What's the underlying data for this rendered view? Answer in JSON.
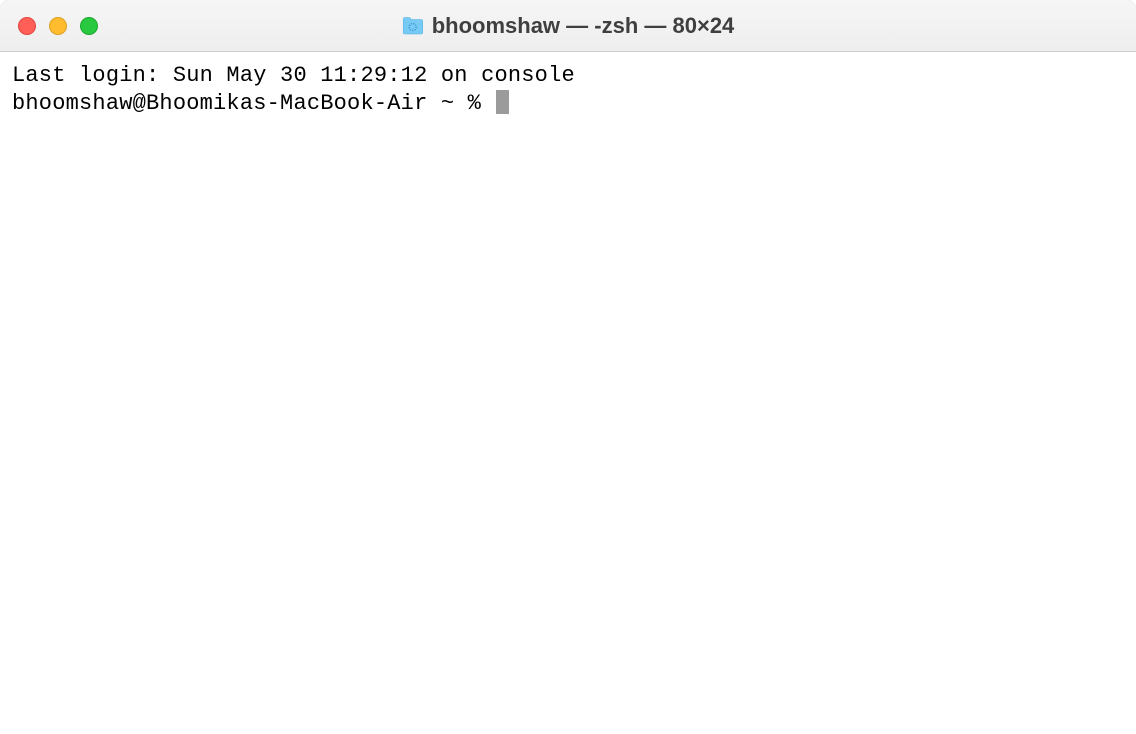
{
  "window": {
    "title": "bhoomshaw — -zsh — 80×24"
  },
  "terminal": {
    "last_login": "Last login: Sun May 30 11:29:12 on console",
    "prompt": "bhoomshaw@Bhoomikas-MacBook-Air ~ % "
  },
  "colors": {
    "close": "#ff5f57",
    "minimize": "#febc2e",
    "zoom": "#28c840",
    "folder_icon": "#5ac1f3"
  }
}
